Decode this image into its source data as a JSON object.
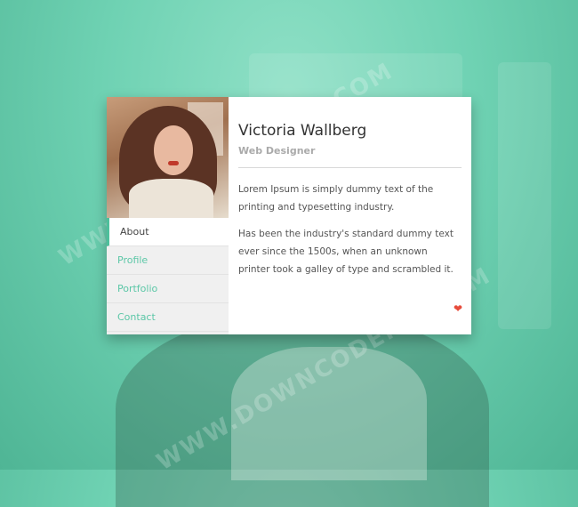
{
  "profile": {
    "name": "Victoria Wallberg",
    "role": "Web Designer",
    "bio": [
      "Lorem Ipsum is simply dummy text of the printing and typesetting industry.",
      "Has been the industry's standard dummy text ever since the 1500s, when an unknown printer took a galley of type and scrambled it."
    ]
  },
  "nav": {
    "items": [
      {
        "label": "About",
        "active": true
      },
      {
        "label": "Profile",
        "active": false
      },
      {
        "label": "Portfolio",
        "active": false
      },
      {
        "label": "Contact",
        "active": false
      }
    ]
  },
  "watermark": {
    "text": "WWW.DOWNCODEMO.COM"
  },
  "icons": {
    "heart": "heart-icon"
  },
  "colors": {
    "accent": "#4dbf9b",
    "heart": "#e74c3c",
    "background": "#6fd2b3"
  }
}
